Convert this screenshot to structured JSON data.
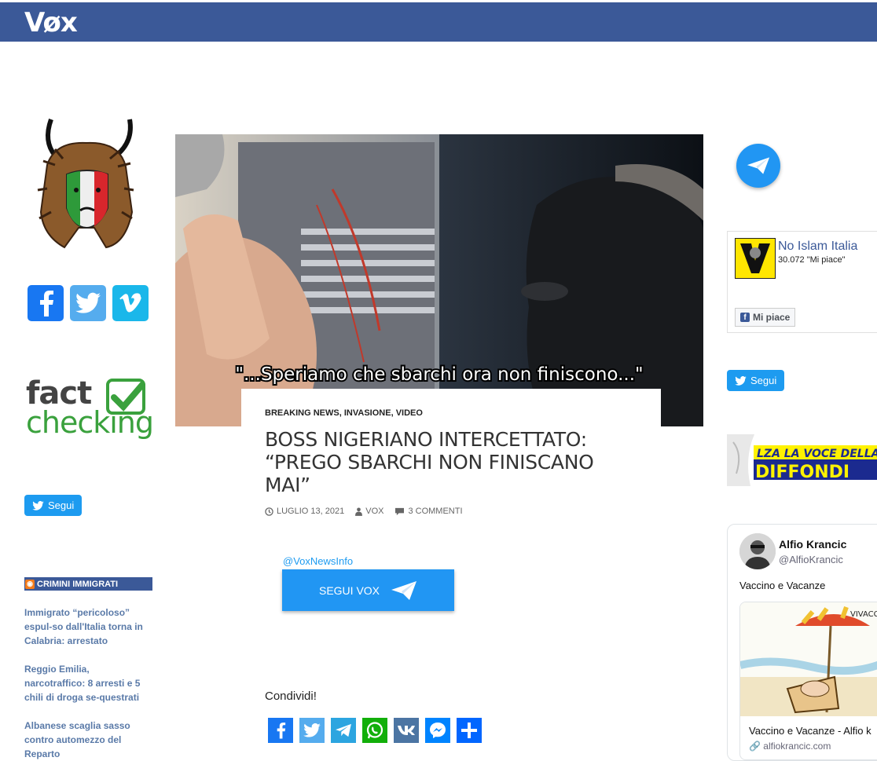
{
  "site": {
    "logo": "Vøx"
  },
  "left": {
    "fact_checking": {
      "top": "fact",
      "bottom": "checking"
    },
    "segui_label": "Segui",
    "rss": {
      "heading": "CRIMINI IMMIGRATI",
      "items": [
        "Immigrato “pericoloso” espul-so dall'Italia torna in Calabria: arrestato",
        "Reggio Emilia, narcotraffico: 8 arresti e 5 chili di droga se-questrati",
        "Albanese scaglia sasso contro automezzo del Reparto"
      ]
    }
  },
  "article": {
    "image_caption": "\"...Speriamo che sbarchi ora non finiscono...\"",
    "categories": [
      "BREAKING NEWS",
      "INVASIONE",
      "VIDEO"
    ],
    "title": "BOSS NIGERIANO INTERCETTATO: “PREGO SBARCHI NON FINISCANO MAI”",
    "date": "LUGLIO 13, 2021",
    "author": "VOX",
    "comments": "3 COMMENTI",
    "telegram_handle": "@VoxNewsInfo",
    "telegram_button": "SEGUI VOX",
    "share_label": "Condividi!"
  },
  "right": {
    "fb_page": {
      "name": "No Islam Italia",
      "likes": "30.072 \"Mi piace\"",
      "button": "Mi piace"
    },
    "segui_label": "Segui",
    "banner_text": [
      "LZA LA VOCE DELLA",
      "DIFFONDI"
    ],
    "tweet": {
      "name": "Alfio Krancic",
      "handle": "@AlfioKrancic",
      "text": "Vaccino e Vacanze",
      "card_title": "Vaccino e Vacanze - Alfio k",
      "card_url": "alfiokrancic.com",
      "cartoon_text": "VIVACCI"
    }
  },
  "colors": {
    "topbar": "#3b5998",
    "facebook": "#1877f2",
    "twitter": "#55acee",
    "vimeo": "#1ab7ea",
    "telegram": "#2196f3"
  }
}
